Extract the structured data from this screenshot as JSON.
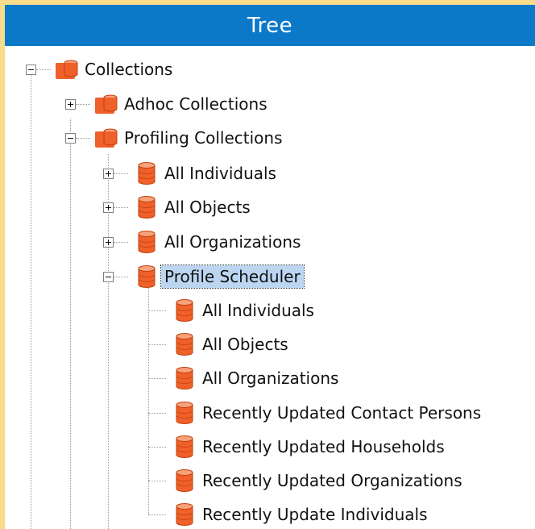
{
  "window": {
    "title": "Tree"
  },
  "tree": {
    "root": {
      "label": "Collections",
      "expanded": true
    },
    "adhoc": {
      "label": "Adhoc Collections",
      "expanded": false
    },
    "profiling": {
      "label": "Profiling Collections",
      "expanded": true
    },
    "profiling_items": [
      {
        "label": "All Individuals",
        "expanded": false
      },
      {
        "label": "All Objects",
        "expanded": false
      },
      {
        "label": "All Organizations",
        "expanded": false
      },
      {
        "label": "Profile Scheduler",
        "expanded": true,
        "selected": true
      }
    ],
    "scheduler_items": [
      {
        "label": "All Individuals"
      },
      {
        "label": "All Objects"
      },
      {
        "label": "All Organizations"
      },
      {
        "label": "Recently Updated Contact Persons"
      },
      {
        "label": "Recently Updated Households"
      },
      {
        "label": "Recently Updated Organizations"
      },
      {
        "label": "Recently Update Individuals"
      }
    ]
  },
  "icons": {
    "folder": "folder-database-icon",
    "database": "database-icon"
  },
  "colors": {
    "title_bar": "#0b78c8",
    "icon_orange": "#f0602a",
    "selection": "#bcd6f2",
    "background": "#f8dc8a"
  }
}
